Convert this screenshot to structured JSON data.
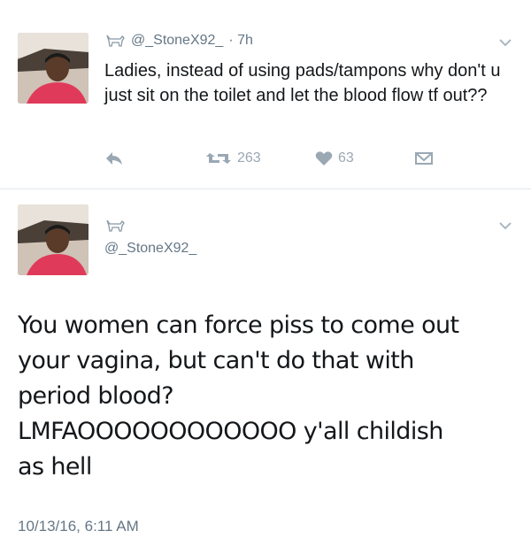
{
  "tweet1": {
    "handle": "@_StoneX92_",
    "time": "· 7h",
    "text": "Ladies, instead of using pads/tampons why don't u just sit on the toilet and let the blood flow tf out??",
    "retweets": "263",
    "likes": "63",
    "icons": [
      "goat-icon",
      "chevron-down-icon",
      "reply-icon",
      "retweet-icon",
      "heart-icon",
      "dm-icon"
    ]
  },
  "tweet2": {
    "handle": "@_StoneX92_",
    "text_lines": [
      "You women can force piss to come out",
      "your vagina, but can't do that with",
      "period blood?",
      "LMFAOOOOOOOOOOOO y'all childish",
      "as hell"
    ],
    "timestamp": "10/13/16, 6:11 AM"
  },
  "colors": {
    "text": "#14171a",
    "muted": "#657786",
    "icon": "#9aa8b4",
    "divider": "#e1e8ed"
  }
}
